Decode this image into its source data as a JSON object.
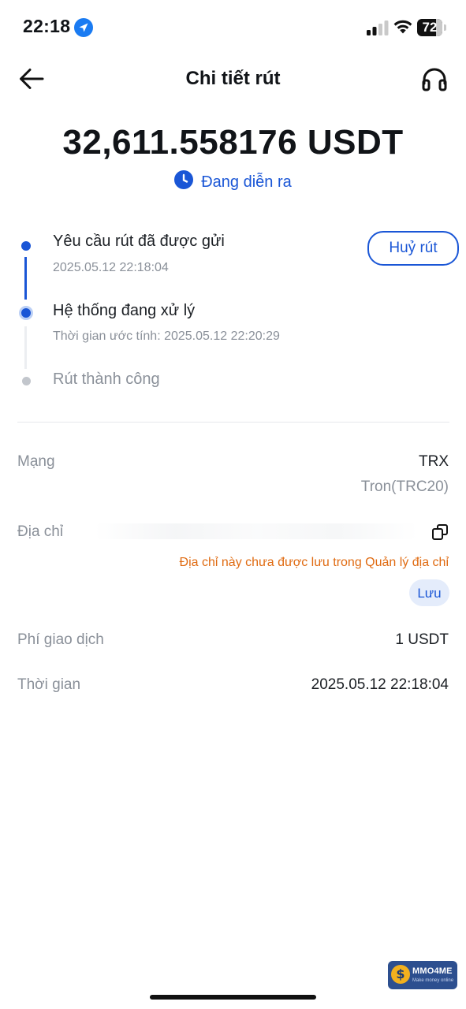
{
  "status_bar": {
    "time": "22:18",
    "battery": "72",
    "battery_level": 0.72,
    "icons": [
      "location-arrow-icon",
      "cellular-signal-icon",
      "wifi-icon",
      "battery-icon"
    ]
  },
  "header": {
    "title": "Chi tiết rút",
    "back_icon": "arrow-left-icon",
    "support_icon": "headset-icon"
  },
  "withdrawal": {
    "amount": "32,611.558176 USDT",
    "status": "Đang diễn ra",
    "status_icon": "clock-icon"
  },
  "timeline": {
    "steps": [
      {
        "title": "Yêu cầu rút đã được gửi",
        "subtitle": "2025.05.12 22:18:04",
        "state": "done"
      },
      {
        "title": "Hệ thống đang xử lý",
        "subtitle": "Thời gian ước tính: 2025.05.12 22:20:29",
        "state": "active"
      },
      {
        "title": "Rút thành công",
        "subtitle": "",
        "state": "pending"
      }
    ],
    "cancel_label": "Huỷ rút"
  },
  "details": {
    "network": {
      "label": "Mạng",
      "value": "TRX",
      "sub": "Tron(TRC20)"
    },
    "address": {
      "label": "Địa chỉ",
      "warning": "Địa chỉ này chưa được lưu trong Quản lý địa chỉ",
      "save_label": "Lưu",
      "copy_icon": "copy-icon"
    },
    "fee": {
      "label": "Phí giao dịch",
      "value": "1 USDT"
    },
    "time": {
      "label": "Thời gian",
      "value": "2025.05.12 22:18:04"
    }
  },
  "watermark": {
    "text": "MMO4ME",
    "sub": "Make money online",
    "symbol": "$"
  },
  "colors": {
    "accent": "#1a56d6",
    "warning": "#e06b12",
    "muted": "#8a9099",
    "text": "#1b1f24"
  }
}
